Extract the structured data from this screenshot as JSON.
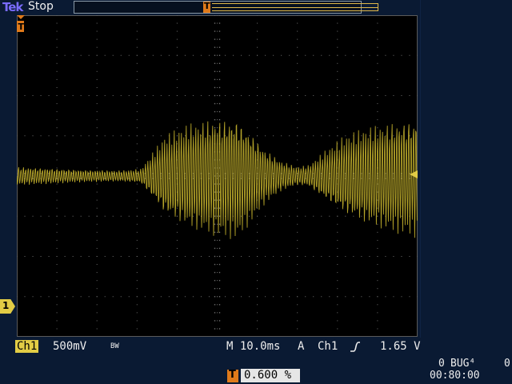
{
  "brand": "Tek",
  "run_state": "Stop",
  "channel": {
    "label": "Ch1",
    "scale": "500mV",
    "bandwidth_limit": "BW",
    "ground_marker": "1",
    "color": "#e2cc45"
  },
  "horizontal": {
    "timebase": "M 10.0ms",
    "trigger_position_icon": "T",
    "trigger_position": "0.600 %"
  },
  "trigger": {
    "mode": "A",
    "source": "Ch1",
    "slope_icon": "rising-edge-icon",
    "level": "1.65 V",
    "color": "#e07a1a"
  },
  "status": {
    "counter": "0",
    "bug_label": "BUG⁴",
    "right_value": "0",
    "clock": "00:80:00"
  },
  "colors": {
    "background": "#0a1a33",
    "graticule": "#000000",
    "trace": "#c8b52e"
  }
}
